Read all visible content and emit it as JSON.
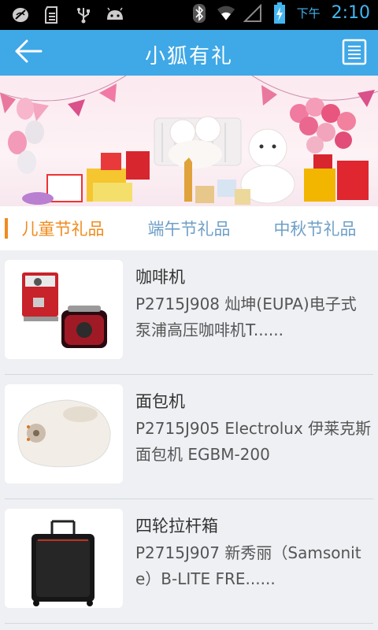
{
  "status_bar": {
    "ampm": "下午",
    "time": "2:10",
    "icons": [
      "sms-blocked-icon",
      "sd-card-icon",
      "usb-icon",
      "android-icon",
      "bluetooth-icon",
      "wifi-icon",
      "signal-icon",
      "battery-charging-icon"
    ]
  },
  "header": {
    "title": "小狐有礼",
    "back_icon": "arrow-left-icon",
    "menu_icon": "list-document-icon"
  },
  "tabs": [
    {
      "label": "儿童节礼品",
      "active": true
    },
    {
      "label": "端午节礼品",
      "active": false
    },
    {
      "label": "中秋节礼品",
      "active": false
    }
  ],
  "products": [
    {
      "name": "咖啡机",
      "desc": "P2715J908 灿坤(EUPA)电子式泵浦高压咖啡机T......"
    },
    {
      "name": "面包机",
      "desc": "P2715J905 Electrolux 伊莱克斯 面包机 EGBM-200"
    },
    {
      "name": "四轮拉杆箱",
      "desc": "P2715J907 新秀丽（Samsonite）B-LITE FRE......"
    }
  ],
  "colors": {
    "title_bar": "#3fa8e7",
    "tab_active": "#f08b1d",
    "tab_inactive": "#6f9fc7",
    "time": "#43b6f0"
  }
}
